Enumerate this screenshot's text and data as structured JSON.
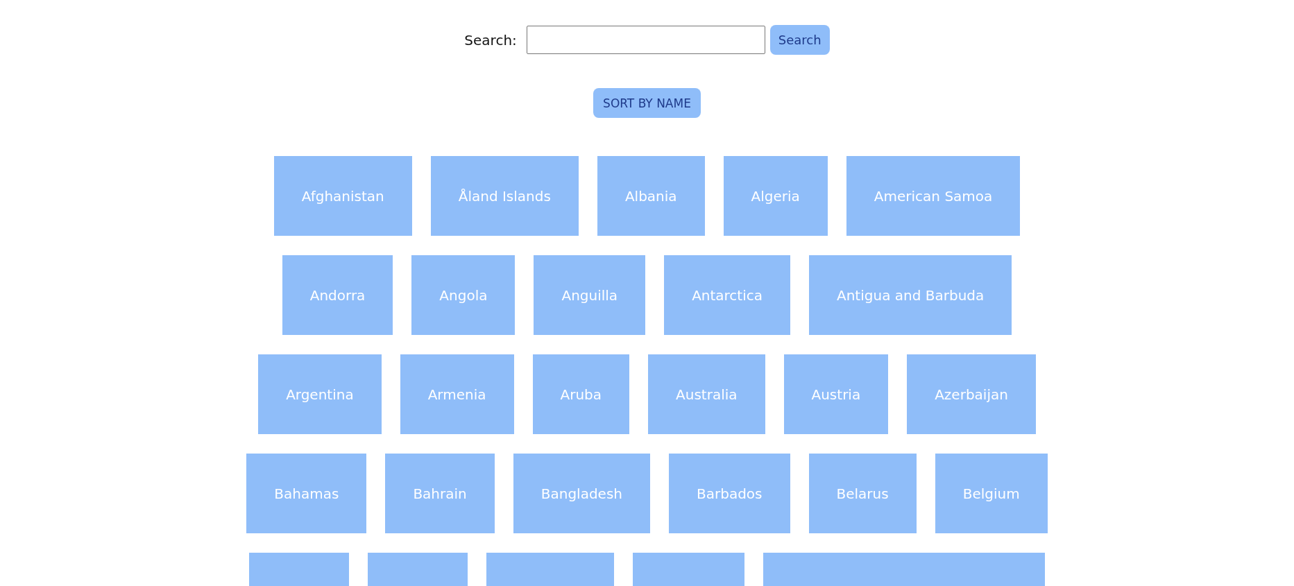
{
  "search": {
    "label": "Search:",
    "button": "Search"
  },
  "sort_button": "SORT BY NAME",
  "rows": [
    {
      "countries": [
        {
          "kind": "country",
          "name": "Afghanistan"
        },
        {
          "kind": "country",
          "name": "Åland Islands"
        },
        {
          "kind": "country",
          "name": "Albania"
        },
        {
          "kind": "country",
          "name": "Algeria"
        },
        {
          "kind": "country",
          "name": "American Samoa"
        }
      ]
    },
    {
      "countries": [
        {
          "kind": "country",
          "name": "Andorra"
        },
        {
          "kind": "country",
          "name": "Angola"
        },
        {
          "kind": "country",
          "name": "Anguilla"
        },
        {
          "kind": "country",
          "name": "Antarctica"
        },
        {
          "kind": "country",
          "name": "Antigua and Barbuda"
        }
      ]
    },
    {
      "countries": [
        {
          "kind": "country",
          "name": "Argentina"
        },
        {
          "kind": "country",
          "name": "Armenia"
        },
        {
          "kind": "country",
          "name": "Aruba"
        },
        {
          "kind": "country",
          "name": "Australia"
        },
        {
          "kind": "country",
          "name": "Austria"
        },
        {
          "kind": "country",
          "name": "Azerbaijan"
        }
      ]
    },
    {
      "countries": [
        {
          "kind": "country",
          "name": "Bahamas"
        },
        {
          "kind": "country",
          "name": "Bahrain"
        },
        {
          "kind": "country",
          "name": "Bangladesh"
        },
        {
          "kind": "country",
          "name": "Barbados"
        },
        {
          "kind": "country",
          "name": "Belarus"
        },
        {
          "kind": "country",
          "name": "Belgium"
        }
      ]
    },
    {
      "countries": [
        {
          "kind": "blank"
        },
        {
          "kind": "blank"
        },
        {
          "kind": "blank"
        },
        {
          "kind": "blank"
        },
        {
          "kind": "blank"
        }
      ]
    }
  ]
}
